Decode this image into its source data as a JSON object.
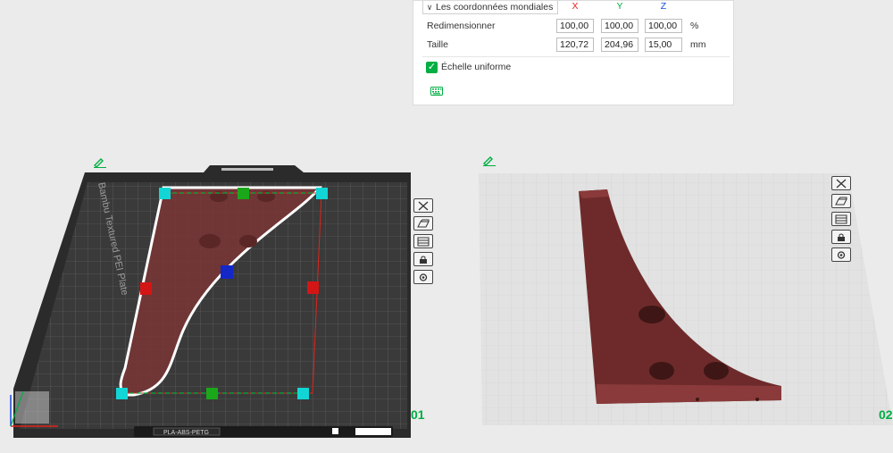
{
  "panel": {
    "coordinates": "Les coordonnées mondiales",
    "axes": [
      "X",
      "Y",
      "Z"
    ],
    "axis_colors": [
      "#e0241b",
      "#00ae42",
      "#1c4ad6"
    ],
    "rows": [
      {
        "label": "Redimensionner",
        "values": [
          "100,00",
          "100,00",
          "100,00"
        ],
        "unit": "%"
      },
      {
        "label": "Taille",
        "values": [
          "120,72",
          "204,96",
          "15,00"
        ],
        "unit": "mm"
      }
    ],
    "uniform_label": "Échelle uniforme",
    "uniform_checked": true
  },
  "plates": [
    {
      "number": "01",
      "material": "PLA-ABS-PETG",
      "plate_text": "Bambu Textured PEI Plate"
    },
    {
      "number": "02"
    }
  ],
  "colors": {
    "accent": "#00ae42",
    "part": "#8a3a3a"
  }
}
